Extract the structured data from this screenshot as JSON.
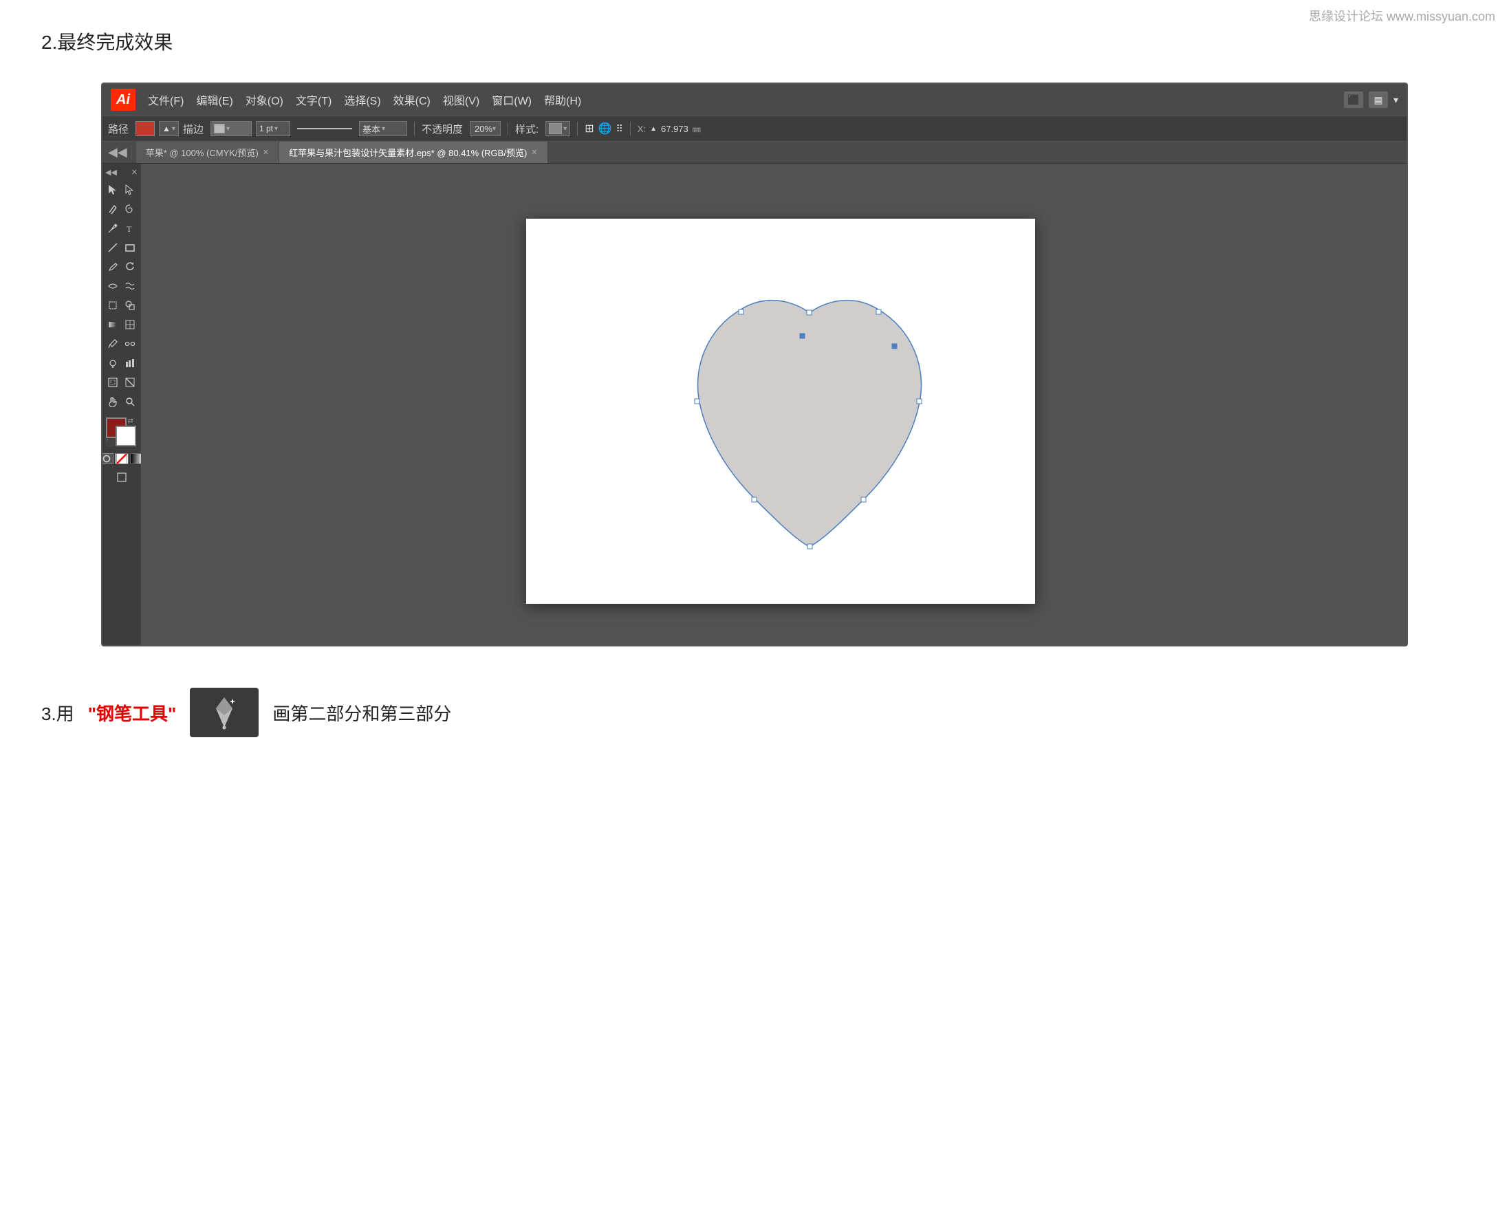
{
  "watermark": "思缘设计论坛 www.missyuan.com",
  "section1": {
    "title": "2.最终完成效果"
  },
  "ai_window": {
    "logo": "Ai",
    "menu_items": [
      "文件(F)",
      "编辑(E)",
      "对象(O)",
      "文字(T)",
      "选择(S)",
      "效果(C)",
      "视图(V)",
      "窗口(W)",
      "帮助(H)"
    ],
    "toolbar": {
      "label": "路径",
      "stroke_label": "描边",
      "stroke_value": "基本",
      "opacity_label": "不透明度",
      "opacity_value": "20%",
      "style_label": "样式:",
      "coord_value": "67.973"
    },
    "tabs": [
      {
        "label": "苹果* @ 100% (CMYK/预览)",
        "active": false
      },
      {
        "label": "红苹果与果汁包装设计矢量素材.eps* @ 80.41% (RGB/预览)",
        "active": true
      }
    ]
  },
  "section2": {
    "prefix": "3.用",
    "highlight": "\"钢笔工具\"",
    "suffix": "画第二部分和第三部分"
  }
}
